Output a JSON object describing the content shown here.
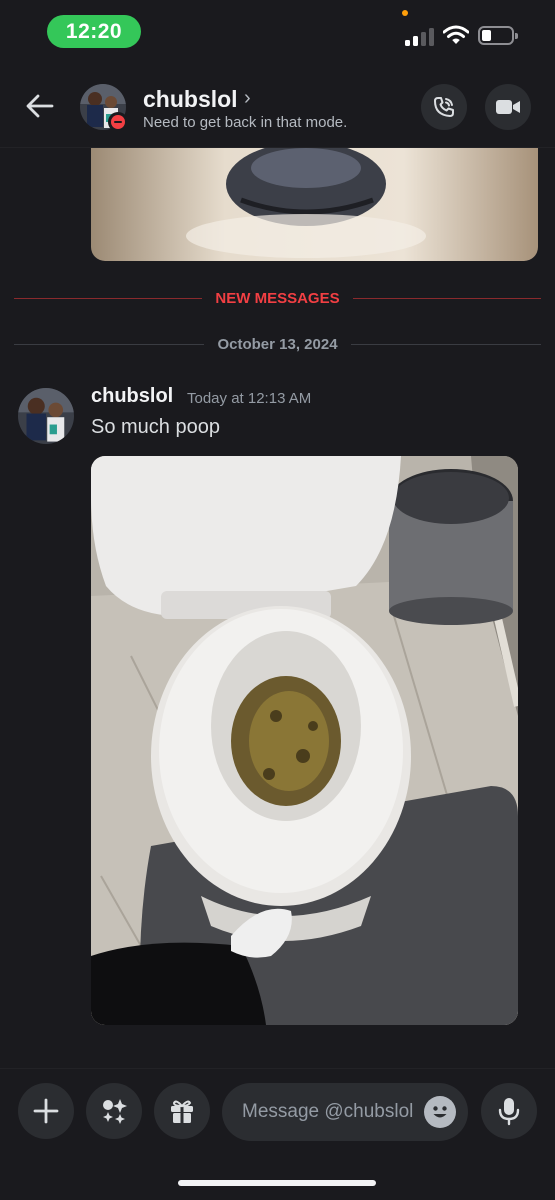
{
  "status_bar": {
    "time": "12:20",
    "accent": "#34c759",
    "icons": [
      "cellular-signal-icon",
      "wifi-icon",
      "battery-icon"
    ]
  },
  "header": {
    "username": "chubslol",
    "chevron": "›",
    "custom_status": "Need to get back in that mode.",
    "presence": "do-not-disturb",
    "icons": [
      "back-arrow-icon",
      "voice-call-icon",
      "video-call-icon"
    ]
  },
  "dividers": {
    "new_messages": "NEW MESSAGES",
    "date": "October 13, 2024"
  },
  "message": {
    "author": "chubslol",
    "timestamp": "Today at 12:13 AM",
    "text": "So much poop",
    "has_image_attachment": true
  },
  "composer": {
    "placeholder": "Message @chubslol",
    "icons": [
      "plus-icon",
      "apps-sparkle-icon",
      "gift-icon",
      "emoji-icon",
      "microphone-icon"
    ]
  },
  "colors": {
    "background": "#1a1a1e",
    "surface": "#2b2d31",
    "new_messages": "#f23f43",
    "muted_text": "#949ba4"
  }
}
